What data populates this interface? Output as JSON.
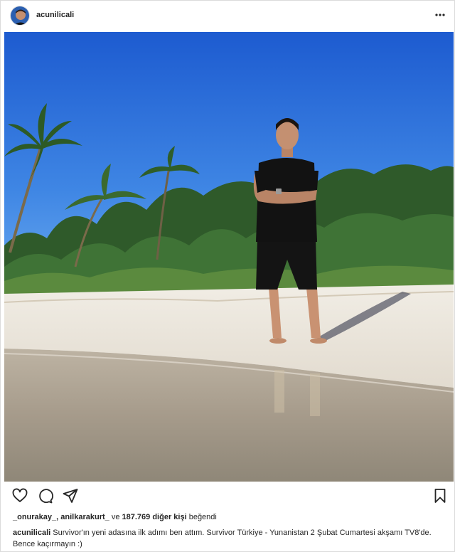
{
  "post": {
    "username": "acunilicali",
    "likes": {
      "user1": "_onurakay_",
      "user2": "anilkarakurt_",
      "conj": "ve",
      "count_text": "187.769 diğer kişi",
      "suffix": "beğendi"
    },
    "caption": {
      "author": "acunilicali",
      "line1": "Survivor'ın yeni adasına ilk adımı ben attım. Survivor Türkiye - Yunanistan 2 Şubat Cumartesi akşamı TV8'de.",
      "line2": "Bence kaçırmayın :)"
    }
  },
  "icons": {
    "header": [
      "avatar",
      "more-options-icon"
    ],
    "actions": [
      "heart-icon",
      "comment-icon",
      "share-icon",
      "bookmark-icon"
    ]
  },
  "colors": {
    "text": "#262626",
    "border": "#dbdbdb",
    "sky_top": "#1f5fd1",
    "sky_bottom": "#5aa2ec",
    "sand": "#ebe6dc",
    "water": "#a89e8f"
  }
}
